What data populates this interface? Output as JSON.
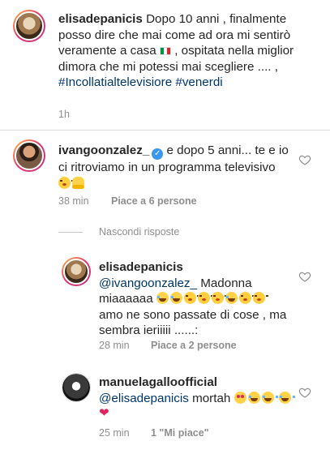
{
  "caption": {
    "username": "elisadepanicis",
    "text": "Dopo 10 anni , finalmente posso dire che mai come ad ora mi sentirò veramente a casa",
    "text_after_flag": ", ospitata nella miglior dimora che mi potessi mai scegliere .... ,",
    "hashtag1": "#Incollatialtelevisiore",
    "hashtag2": "#venerdi",
    "time": "1h"
  },
  "comment1": {
    "username": "ivangoonzalez_",
    "text": "e dopo 5 anni... te e io ci ritroviamo in un programma televisivo",
    "time": "38 min",
    "likes": "Piace a 6 persone"
  },
  "hide_replies": "Nascondi risposte",
  "reply1": {
    "username": "elisadepanicis",
    "mention": "@ivangoonzalez_",
    "text": "Madonna miaaaaaa",
    "text2": "amo ne sono passate di cose , ma sembra ieriiiii ......:",
    "time": "28 min",
    "likes": "Piace a 2 persone"
  },
  "reply2": {
    "username": "manuelagallоofficial",
    "mention": "@elisadepanicis",
    "text": "mortah",
    "time": "25 min",
    "likes": "1 \"Mi piace\""
  },
  "colors": {
    "link": "#00376b",
    "muted": "#8e8e8e",
    "verified": "#3897f0"
  }
}
